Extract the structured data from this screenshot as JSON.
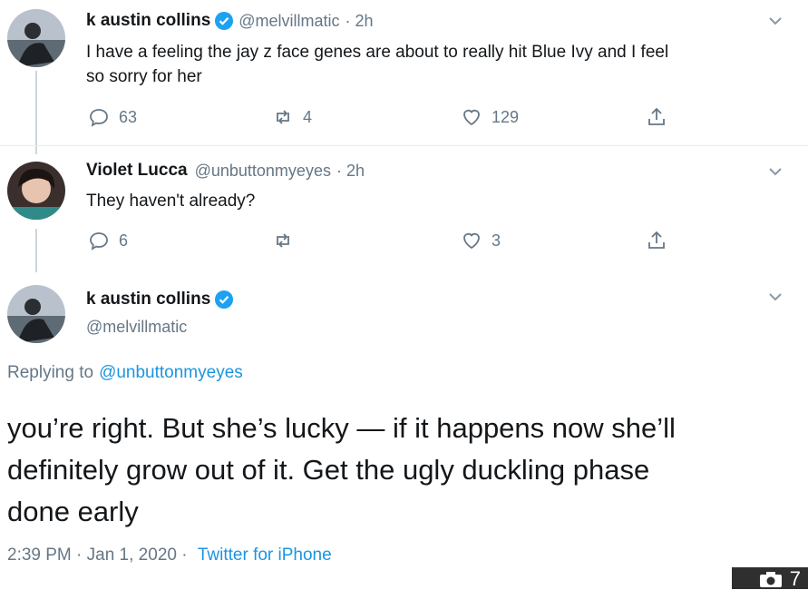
{
  "tweets": [
    {
      "name": "k austin collins",
      "handle": "@melvillmatic",
      "time": "· 2h",
      "text_line1": "I have a feeling the jay z face genes are about to really hit Blue Ivy and I feel",
      "text_line2": "so sorry for her",
      "replies": "63",
      "retweets": "4",
      "likes": "129"
    },
    {
      "name": "Violet Lucca",
      "handle": "@unbuttonmyeyes",
      "time": "· 2h",
      "text_line1": "They haven't already?",
      "replies": "6",
      "retweets": "",
      "likes": "3"
    }
  ],
  "main_tweet": {
    "name": "k austin collins",
    "handle": "@melvillmatic",
    "replying_label": "Replying to",
    "replying_handle": "@unbuttonmyeyes",
    "text_line1": "you’re right. But she’s lucky — if it happens now she’ll",
    "text_line2": "definitely grow out of it. Get the ugly duckling phase",
    "text_line3": "done early",
    "timestamp": "2:39 PM · Jan 1, 2020 ·",
    "source": "Twitter for iPhone"
  },
  "photo_badge": {
    "count": "7"
  },
  "colors": {
    "accent": "#1da1f2",
    "muted": "#657786",
    "text": "#14171a"
  }
}
